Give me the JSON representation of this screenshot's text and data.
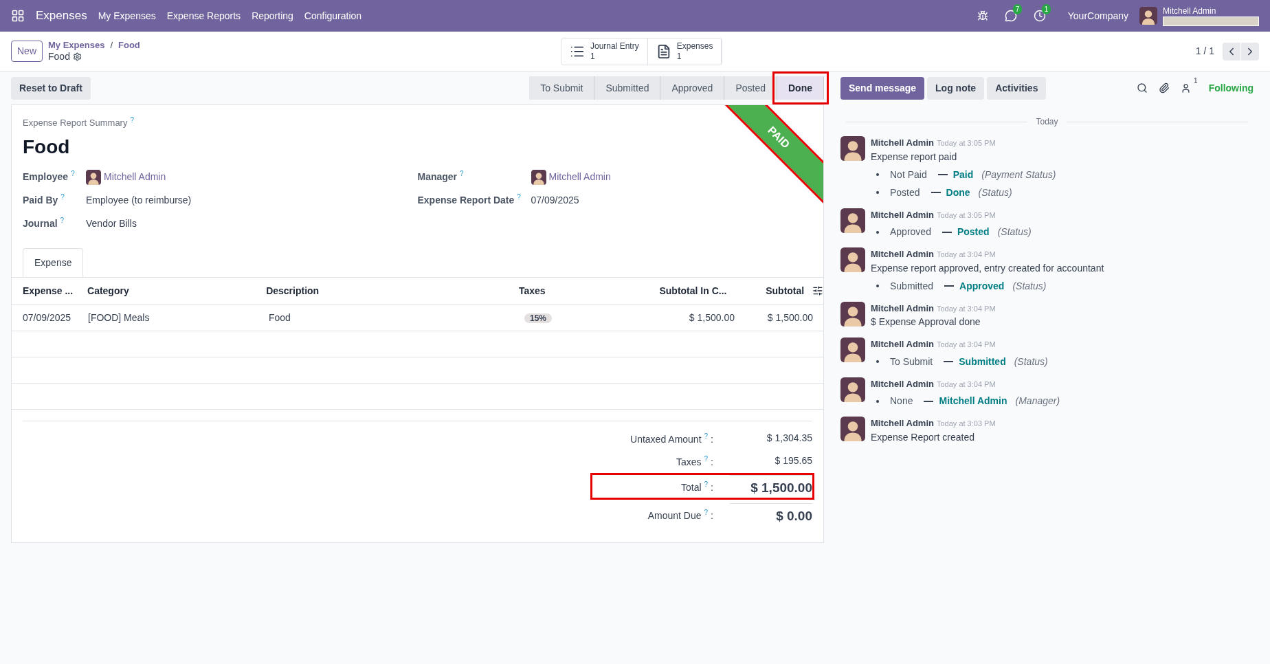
{
  "navbar": {
    "app": "Expenses",
    "menu": [
      "My Expenses",
      "Expense Reports",
      "Reporting",
      "Configuration"
    ],
    "messages_count": "7",
    "activities_count": "1",
    "company": "YourCompany",
    "user": "Mitchell Admin"
  },
  "control_panel": {
    "new_button": "New",
    "breadcrumb": "My Expenses",
    "breadcrumb_separator": "/",
    "breadcrumb_current": "Food",
    "record_name": "Food",
    "smart_buttons": [
      {
        "label": "Journal Entry",
        "count": "1",
        "kind": "list"
      },
      {
        "label": "Expenses",
        "count": "1",
        "kind": "file"
      }
    ],
    "pager": "1 / 1"
  },
  "actions": {
    "reset_button": "Reset to Draft"
  },
  "stages": [
    {
      "label": "To Submit",
      "selected": false,
      "highlighted": false
    },
    {
      "label": "Submitted",
      "selected": false,
      "highlighted": false
    },
    {
      "label": "Approved",
      "selected": false,
      "highlighted": false
    },
    {
      "label": "Posted",
      "selected": false,
      "highlighted": false
    },
    {
      "label": "Done",
      "selected": true,
      "highlighted": true
    }
  ],
  "chatter_buttons": [
    {
      "label": "Send message",
      "selected": true
    },
    {
      "label": "Log note",
      "selected": false
    },
    {
      "label": "Activities",
      "selected": false
    }
  ],
  "followers_count": "1",
  "following": "Following",
  "form": {
    "ribbon": "PAID",
    "ribbon_highlighted": true,
    "summary_label": "Expense Report Summary",
    "summary_help": "?",
    "title": "Food",
    "left_fields": [
      {
        "label": "Employee",
        "help": "?",
        "value": "Mitchell Admin",
        "kind": "user"
      },
      {
        "label": "Paid By",
        "help": "?",
        "value": "Employee (to reimburse)",
        "kind": "text"
      },
      {
        "label": "Journal",
        "help": "?",
        "value": "Vendor Bills",
        "kind": "text"
      }
    ],
    "right_fields": [
      {
        "label": "Manager",
        "help": "?",
        "value": "Mitchell Admin",
        "kind": "user"
      },
      {
        "label": "Expense Report Date",
        "help": "?",
        "value": "07/09/2025",
        "kind": "text"
      }
    ],
    "tabs": [
      {
        "label": "Expense",
        "selected": true
      }
    ],
    "table": {
      "columns": [
        "Expense ...",
        "Category",
        "Description",
        "Taxes",
        "Subtotal In C...",
        "Subtotal"
      ],
      "rows": [
        {
          "date": "07/09/2025",
          "category": "[FOOD] Meals",
          "description": "Food",
          "tax": "15%",
          "subtotal_company": "$ 1,500.00",
          "subtotal": "$ 1,500.00"
        }
      ]
    },
    "totals": [
      {
        "label": "Untaxed Amount",
        "help": "?",
        "colon": ":",
        "value": "$ 1,304.35",
        "kind": "plain",
        "highlighted": false
      },
      {
        "label": "Taxes",
        "help": "?",
        "colon": ":",
        "value": "$ 195.65",
        "kind": "plain",
        "highlighted": false
      },
      {
        "label": "Total",
        "help": "?",
        "colon": ":",
        "value": "$ 1,500.00",
        "kind": "big",
        "highlighted": true
      },
      {
        "label": "Amount Due",
        "help": "?",
        "colon": ":",
        "value": "$ 0.00",
        "kind": "big",
        "highlighted": false
      }
    ]
  },
  "chatter": {
    "day": "Today",
    "messages": [
      {
        "author": "Mitchell Admin",
        "time": "Today at 3:05 PM",
        "body": "Expense report paid",
        "changes": [
          {
            "old": "Not Paid",
            "new": "Paid",
            "field": "(Payment Status)"
          },
          {
            "old": "Posted",
            "new": "Done",
            "field": "(Status)"
          }
        ]
      },
      {
        "author": "Mitchell Admin",
        "time": "Today at 3:05 PM",
        "changes": [
          {
            "old": "Approved",
            "new": "Posted",
            "field": "(Status)"
          }
        ]
      },
      {
        "author": "Mitchell Admin",
        "time": "Today at 3:04 PM",
        "body": "Expense report approved, entry created for accountant",
        "changes": [
          {
            "old": "Submitted",
            "new": "Approved",
            "field": "(Status)"
          }
        ]
      },
      {
        "author": "Mitchell Admin",
        "time": "Today at 3:04 PM",
        "body": "$ Expense Approval done"
      },
      {
        "author": "Mitchell Admin",
        "time": "Today at 3:04 PM",
        "changes": [
          {
            "old": "To Submit",
            "new": "Submitted",
            "field": "(Status)"
          }
        ]
      },
      {
        "author": "Mitchell Admin",
        "time": "Today at 3:04 PM",
        "changes": [
          {
            "old": "None",
            "new": "Mitchell Admin",
            "field": "(Manager)"
          }
        ]
      },
      {
        "author": "Mitchell Admin",
        "time": "Today at 3:03 PM",
        "body": "Expense Report created"
      }
    ]
  }
}
